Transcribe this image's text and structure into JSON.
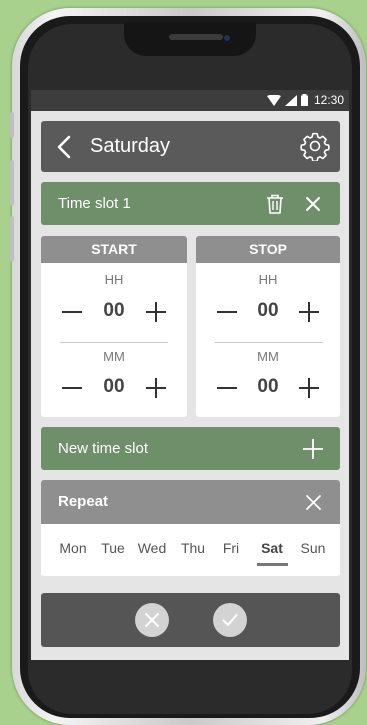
{
  "status_bar": {
    "time": "12:30"
  },
  "header": {
    "title": "Saturday"
  },
  "time_slot": {
    "title": "Time slot 1"
  },
  "start": {
    "label": "START",
    "hours_label": "HH",
    "hours": "00",
    "minutes_label": "MM",
    "minutes": "00"
  },
  "stop": {
    "label": "STOP",
    "hours_label": "HH",
    "hours": "00",
    "minutes_label": "MM",
    "minutes": "00"
  },
  "new_slot": {
    "label": "New time slot"
  },
  "repeat": {
    "title": "Repeat",
    "days": [
      "Mon",
      "Tue",
      "Wed",
      "Thu",
      "Fri",
      "Sat",
      "Sun"
    ],
    "selected": "Sat"
  },
  "colors": {
    "background": "#a9d18e",
    "green_accent": "#6f8f6a",
    "header_dark": "#5a5a5a",
    "card_head_gray": "#8f8f8f"
  },
  "icons": {
    "back": "chevron-left-icon",
    "settings": "gear-icon",
    "delete": "trash-icon",
    "close": "close-icon",
    "add": "plus-icon",
    "decrement": "minus-icon",
    "increment": "plus-icon",
    "cancel": "cancel-icon",
    "confirm": "check-icon"
  }
}
